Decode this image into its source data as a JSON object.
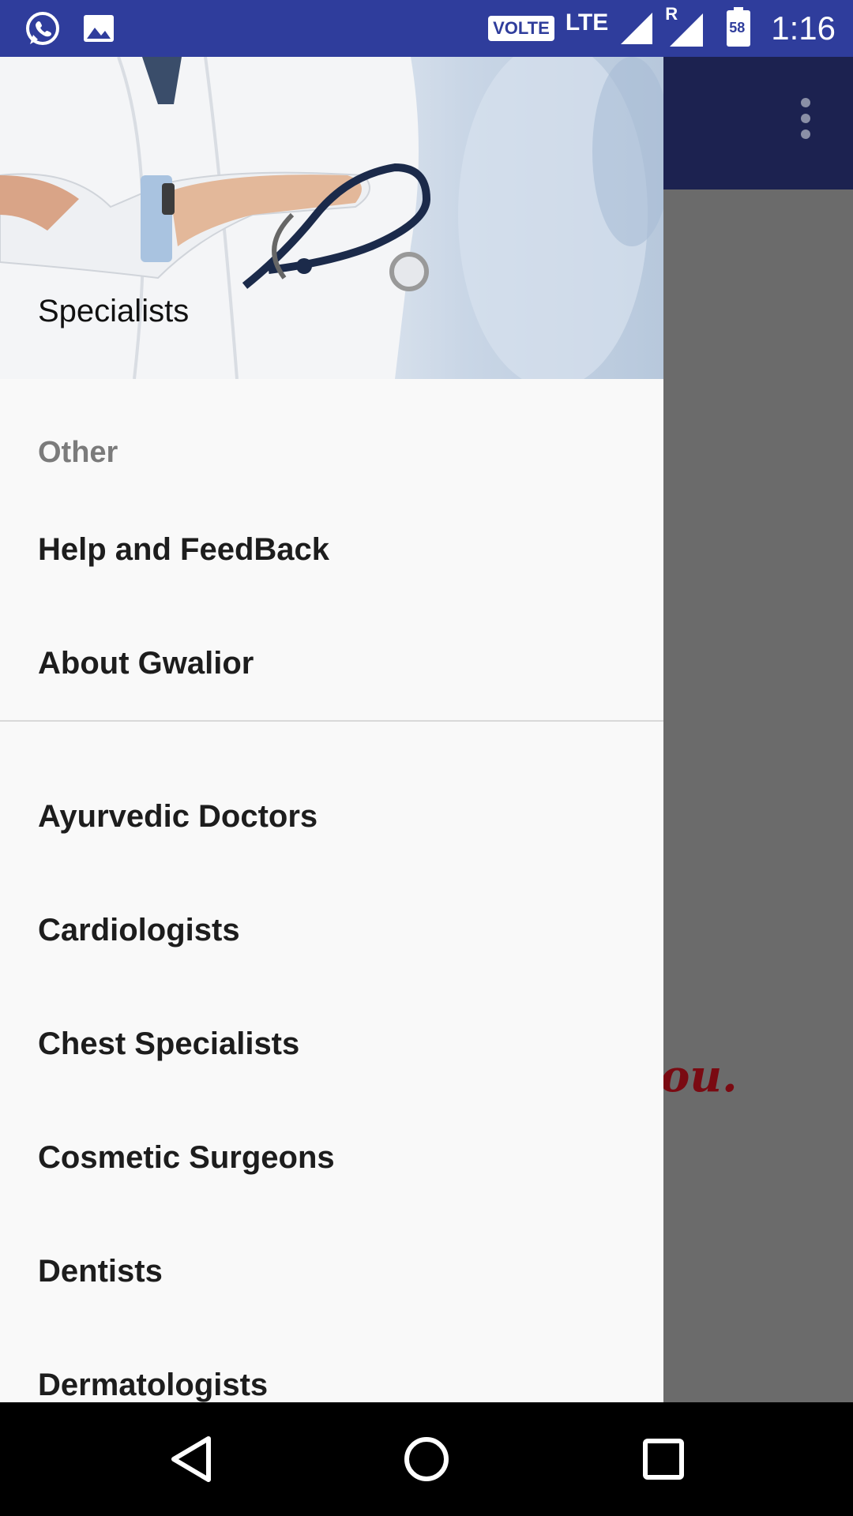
{
  "status_bar": {
    "left_icons": [
      "whatsapp-icon",
      "image-icon"
    ],
    "volte": "VOLTE",
    "network": "LTE",
    "roaming": "R",
    "battery_level": "58",
    "time": "1:16"
  },
  "background": {
    "partial_text": "ou."
  },
  "drawer": {
    "header_title": "Specialists",
    "section_label": "Other",
    "other_items": [
      "Help and FeedBack",
      "About Gwalior"
    ],
    "specialist_items": [
      "Ayurvedic Doctors",
      "Cardiologists",
      "Chest Specialists",
      "Cosmetic Surgeons",
      "Dentists",
      "Dermatologists"
    ]
  },
  "nav_bar": {
    "buttons": [
      "back-icon",
      "home-icon",
      "recents-icon"
    ]
  },
  "colors": {
    "status_bar": "#2f3d9c",
    "app_bar": "#1c2250",
    "drawer_bg": "#f9f9f9",
    "scrim": "#6b6b6b",
    "accent_text": "#7a0a12"
  }
}
